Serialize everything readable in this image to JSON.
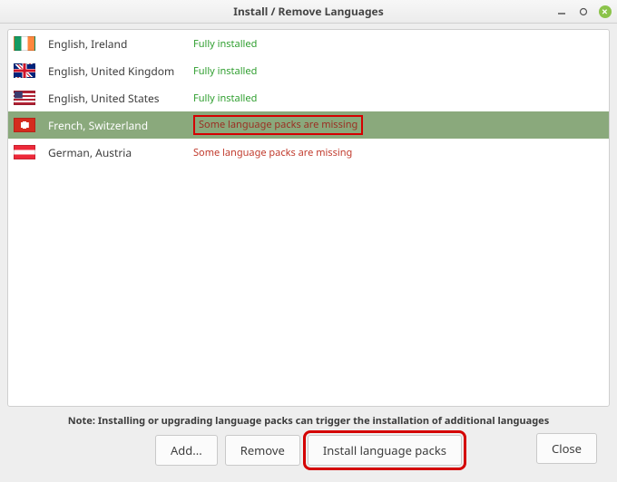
{
  "window": {
    "title": "Install / Remove Languages"
  },
  "status_labels": {
    "fully_installed": "Fully installed",
    "packs_missing": "Some language packs are missing"
  },
  "languages": [
    {
      "name": "English, Ireland",
      "flag": "flag-ie",
      "status_key": "fully_installed",
      "status_class": "installed",
      "selected": false,
      "highlight": false
    },
    {
      "name": "English, United Kingdom",
      "flag": "flag-gb",
      "status_key": "fully_installed",
      "status_class": "installed",
      "selected": false,
      "highlight": false
    },
    {
      "name": "English, United States",
      "flag": "flag-us",
      "status_key": "fully_installed",
      "status_class": "installed",
      "selected": false,
      "highlight": false
    },
    {
      "name": "French, Switzerland",
      "flag": "flag-ch",
      "status_key": "packs_missing",
      "status_class": "missing",
      "selected": true,
      "highlight": true
    },
    {
      "name": "German, Austria",
      "flag": "flag-at",
      "status_key": "packs_missing",
      "status_class": "missing",
      "selected": false,
      "highlight": false
    }
  ],
  "note": "Note: Installing or upgrading language packs can trigger the installation of additional languages",
  "buttons": {
    "add": "Add...",
    "remove": "Remove",
    "install_packs": "Install language packs",
    "close": "Close"
  },
  "highlights": {
    "install_packs_button": true
  }
}
